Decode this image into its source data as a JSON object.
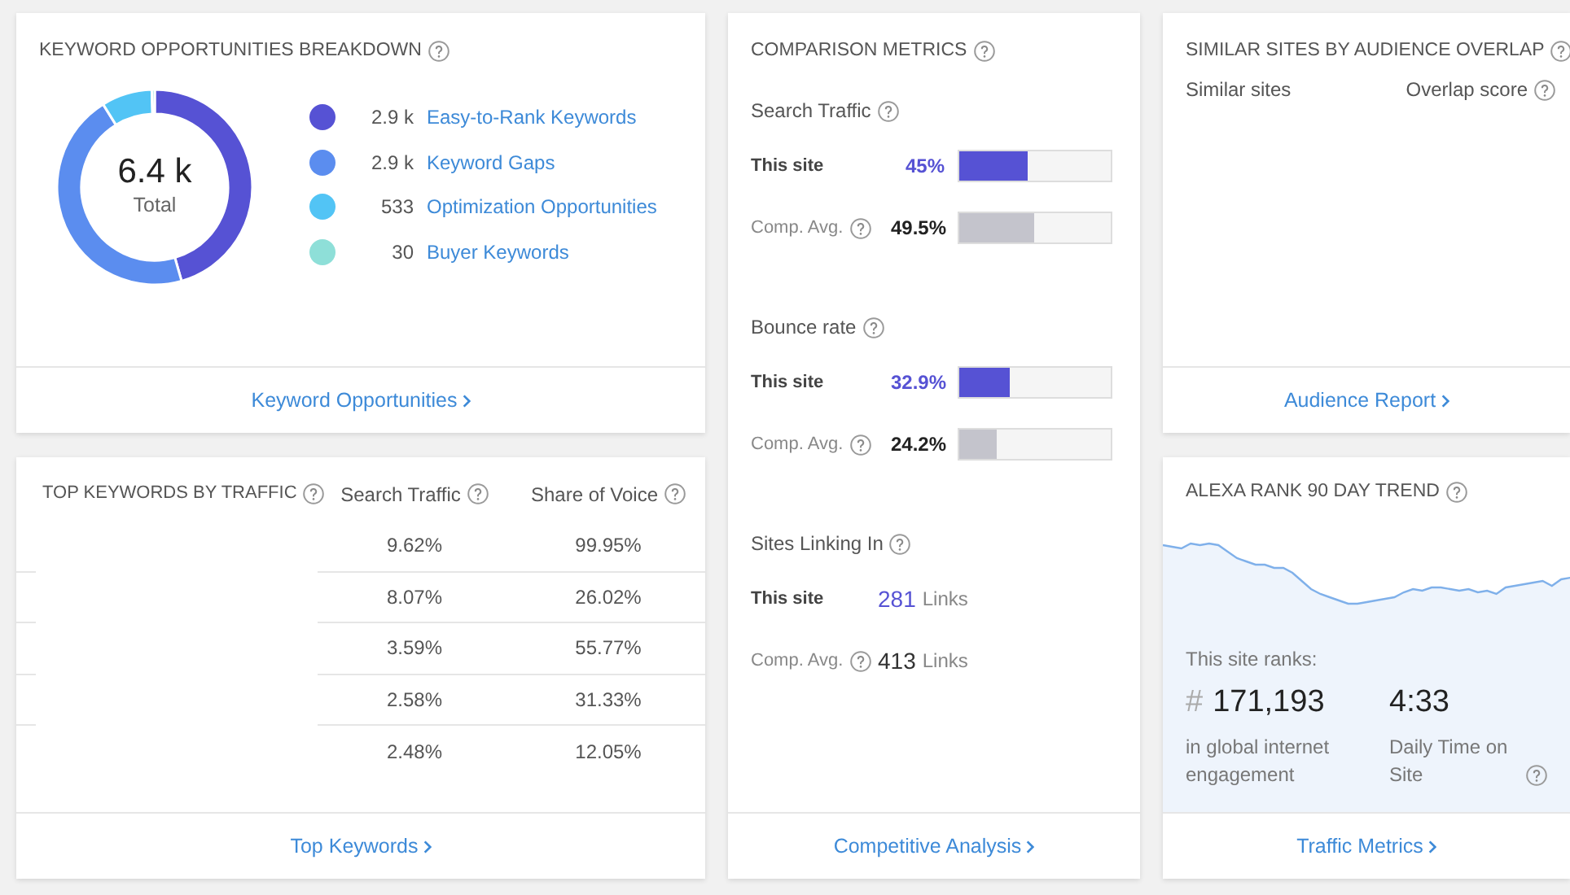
{
  "keyword_opportunities": {
    "title": "KEYWORD OPPORTUNITIES BREAKDOWN",
    "total": "6.4 k",
    "total_label": "Total",
    "chart_data": {
      "type": "donut",
      "categories": [
        "Easy-to-Rank Keywords",
        "Keyword Gaps",
        "Optimization Opportunities",
        "Buyer Keywords"
      ],
      "values": [
        45.57,
        45.57,
        8.38,
        0.48
      ]
    },
    "legend": [
      {
        "value": "2.9 k",
        "color": "#5652d4"
      },
      {
        "value": "2.9 k",
        "color": "#5b8def"
      },
      {
        "value": "533",
        "color": "#52c4f5"
      },
      {
        "value": "30",
        "color": "#8edfd8"
      }
    ],
    "footer_link": "Keyword Opportunities"
  },
  "top_keywords": {
    "title": "TOP KEYWORDS BY TRAFFIC",
    "columns": [
      "Search Traffic",
      "Share of Voice"
    ],
    "rows": [
      {
        "search_traffic": "9.62%",
        "share_of_voice": "99.95%"
      },
      {
        "search_traffic": "8.07%",
        "share_of_voice": "26.02%"
      },
      {
        "search_traffic": "3.59%",
        "share_of_voice": "55.77%"
      },
      {
        "search_traffic": "2.58%",
        "share_of_voice": "31.33%"
      },
      {
        "search_traffic": "2.48%",
        "share_of_voice": "12.05%"
      }
    ],
    "footer_link": "Top Keywords"
  },
  "comparison_metrics": {
    "title": "COMPARISON METRICS",
    "sections": [
      {
        "kind": "bar",
        "title": "Search Traffic",
        "rows": [
          {
            "kind": "site",
            "label": "This site",
            "value": "45%",
            "level": 0.45
          },
          {
            "kind": "average",
            "label": "Comp. Avg.",
            "value": "49.5%",
            "level": 0.495
          }
        ]
      },
      {
        "kind": "bar",
        "title": "Bounce rate",
        "rows": [
          {
            "kind": "site",
            "label": "This site",
            "value": "32.9%",
            "level": 0.329
          },
          {
            "kind": "average",
            "label": "Comp. Avg.",
            "value": "24.2%",
            "level": 0.242
          }
        ]
      },
      {
        "kind": "links",
        "title": "Sites Linking In",
        "rows": [
          {
            "kind": "site",
            "label": "This site",
            "value": "281",
            "unit": "Links"
          },
          {
            "kind": "average",
            "label": "Comp. Avg.",
            "value": "413",
            "unit": "Links"
          }
        ]
      }
    ],
    "footer_link": "Competitive Analysis"
  },
  "similar_sites": {
    "title": "SIMILAR SITES BY AUDIENCE OVERLAP",
    "columns": [
      {
        "label": "Similar sites",
        "help": false
      },
      {
        "label": "Overlap score",
        "help": true
      }
    ],
    "footer_link": "Audience Report"
  },
  "alexa_rank": {
    "title": "ALEXA RANK 90 DAY TREND",
    "rank_caption": "This site ranks:",
    "rank_prefix": "#",
    "rank": "171,193",
    "rank_note": "in global internet engagement",
    "time": "4:33",
    "time_label": "Daily Time on Site",
    "footer_link": "Traffic Metrics"
  }
}
